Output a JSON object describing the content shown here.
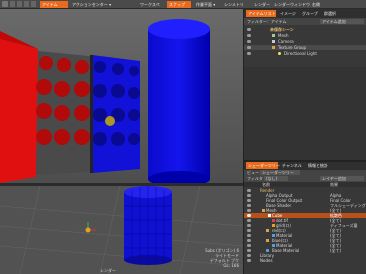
{
  "toolbar": {
    "items": [
      {
        "label": "アイテム",
        "active": true
      },
      {
        "label": "アクションセンター ▾",
        "active": false
      },
      {
        "label": "ワークスペ",
        "active": false
      },
      {
        "label": "スナップ",
        "active": true
      },
      {
        "label": "作業平面 ▾",
        "active": false
      },
      {
        "label": "シンメトリ",
        "active": false
      },
      {
        "label": "レンダー",
        "active": false
      },
      {
        "label": "レンダーウィンドウ",
        "active": false
      }
    ],
    "right_label": "右側"
  },
  "item_list": {
    "tabs": [
      "アイテムリスト",
      "イメージ",
      "グループ",
      "群選択"
    ],
    "filter_label": "フィルター：アイテム",
    "add_label": "アイテム追加",
    "items": [
      {
        "label": "未保存シーン",
        "level": 0,
        "bold": true
      },
      {
        "label": "Mesh",
        "level": 1,
        "bold": false
      },
      {
        "label": "Camera",
        "level": 1,
        "bold": false
      },
      {
        "label": "Texture Group",
        "level": 1,
        "bold": false
      },
      {
        "label": "Directional Light",
        "level": 2,
        "bold": false
      }
    ]
  },
  "shader_tree": {
    "tabs": [
      "シェーダーツリー",
      "チャンネル",
      "情報と統計"
    ],
    "view_label": "ビュー",
    "view_value": "シェーダーツリー",
    "filter_label": "フィルター",
    "filter_value": "(なし)",
    "add_label": "レイヤー追加",
    "col_name": "名前",
    "col_effect": "効果",
    "rows": [
      {
        "name": "Render",
        "effect": "",
        "level": 0,
        "selected": false
      },
      {
        "name": "Alpha Output",
        "effect": "Alpha",
        "level": 1,
        "selected": false
      },
      {
        "name": "Final Color Output",
        "effect": "Final Color",
        "level": 1,
        "selected": false
      },
      {
        "name": "Base Shader",
        "effect": "フルシェーディング",
        "level": 1,
        "selected": false
      },
      {
        "name": "Mesh",
        "effect": "(全て)",
        "level": 1,
        "selected": false
      },
      {
        "name": "Cube",
        "effect": "拡散色",
        "level": 2,
        "selected": true
      },
      {
        "name": "dot.tif",
        "effect": "(全て)",
        "level": 3,
        "selected": false
      },
      {
        "name": "grid(ロ)",
        "effect": "ディフューズ量",
        "level": 3,
        "selected": false
      },
      {
        "name": "red(ロ)",
        "effect": "(全て)",
        "level": 2,
        "selected": false
      },
      {
        "name": "Material",
        "effect": "(全て)",
        "level": 3,
        "selected": false
      },
      {
        "name": "blue(ロ)",
        "effect": "(全て)",
        "level": 2,
        "selected": false
      },
      {
        "name": "Material",
        "effect": "(全て)",
        "level": 3,
        "selected": false
      },
      {
        "name": "Base Material",
        "effect": "(全て)",
        "level": 2,
        "selected": false
      },
      {
        "name": "Library",
        "effect": "",
        "level": 0,
        "selected": false
      },
      {
        "name": "Nodes",
        "effect": "",
        "level": 0,
        "selected": false
      }
    ]
  },
  "viewport_bottom": {
    "info_lines": [
      "Subs (ポリゴン) 6",
      "ライトモード",
      "デフォルト ブク",
      "GL: 166"
    ],
    "corner_label": "レンダー"
  }
}
